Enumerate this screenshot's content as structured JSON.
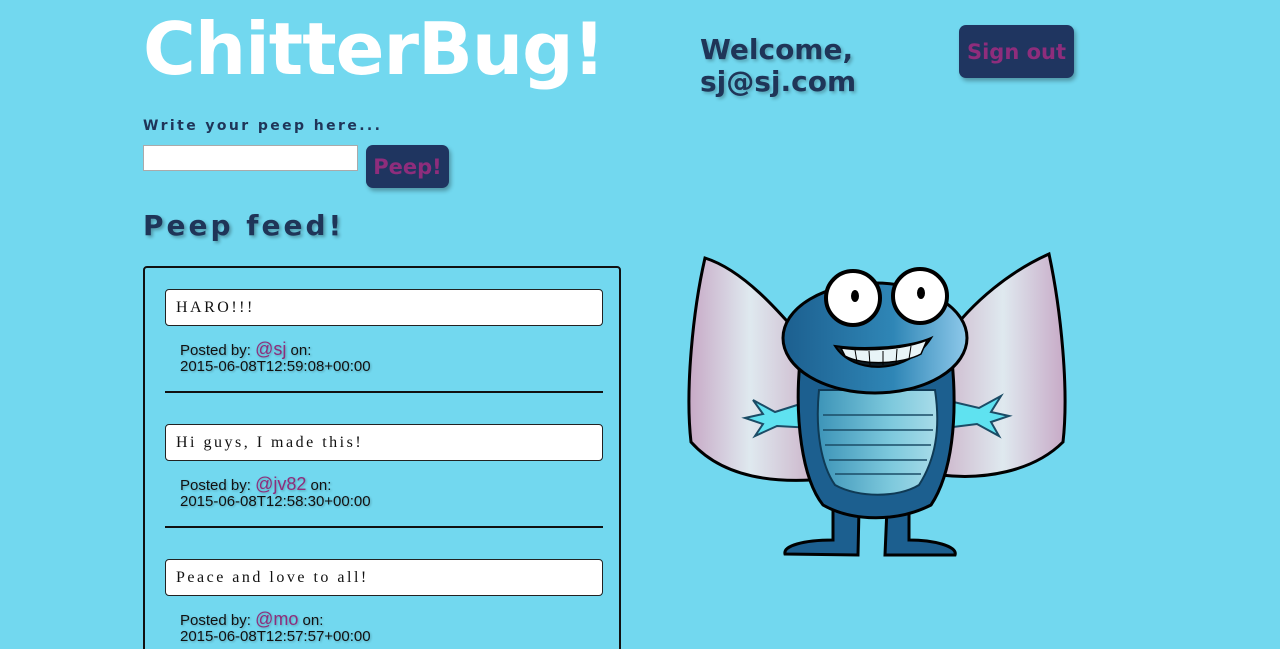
{
  "header": {
    "logo": "ChitterBug!",
    "welcome": "Welcome, sj@sj.com",
    "sign_out_label": "Sign out"
  },
  "composer": {
    "prompt": "Write your peep here...",
    "input_value": "",
    "button_label": "Peep!"
  },
  "feed": {
    "title": "Peep feed!",
    "posted_by_label": "Posted by:",
    "on_label": "on:",
    "peeps": [
      {
        "text": "HARO!!!",
        "handle": "@sj",
        "timestamp": "2015-06-08T12:59:08+00:00"
      },
      {
        "text": "Hi guys, I made this!",
        "handle": "@jv82",
        "timestamp": "2015-06-08T12:58:30+00:00"
      },
      {
        "text": "Peace and love to all!",
        "handle": "@mo",
        "timestamp": "2015-06-08T12:57:57+00:00"
      }
    ]
  },
  "colors": {
    "background": "#72d8ef",
    "navy": "#1f3560",
    "accent": "#8e2d7c"
  }
}
